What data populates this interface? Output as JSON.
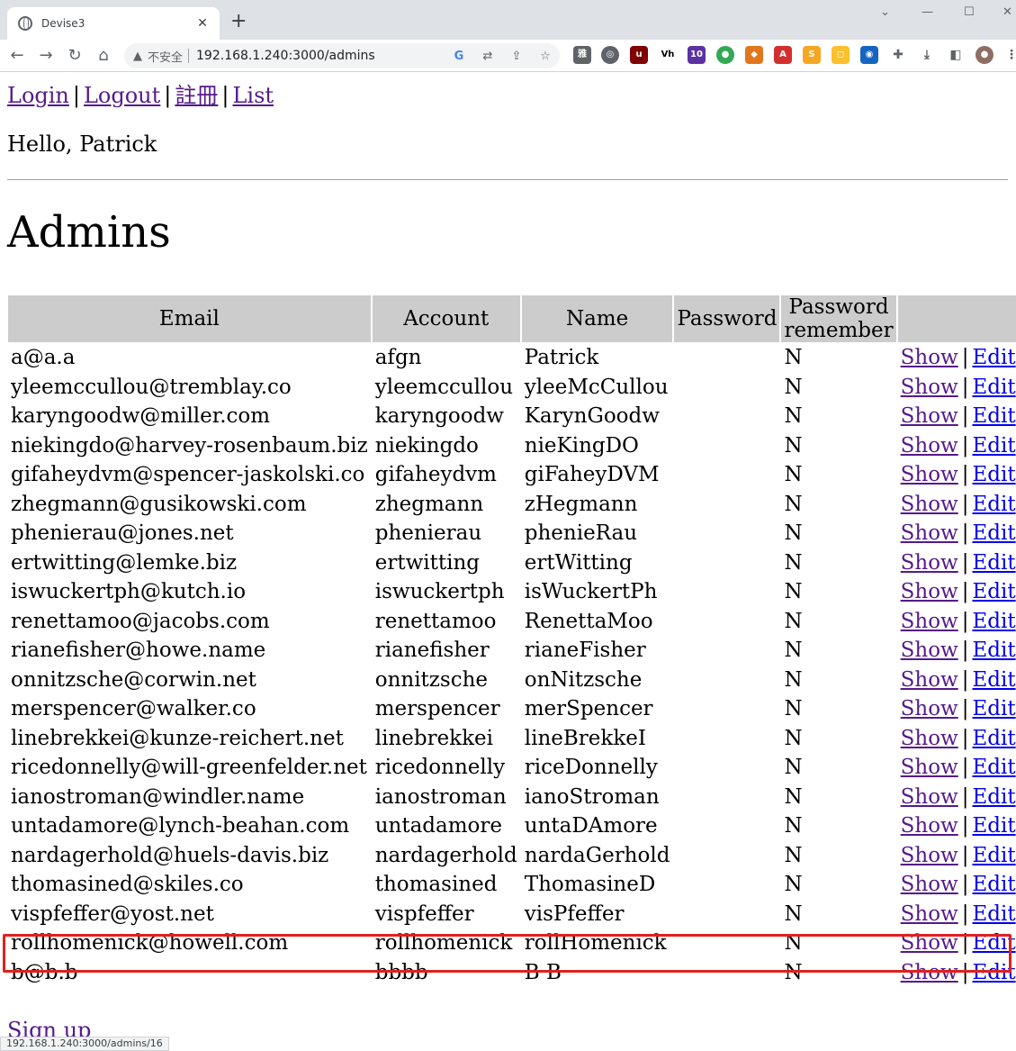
{
  "browser": {
    "tab_title": "Devise3",
    "new_tab": "+",
    "security_label": "不安全",
    "url": "192.168.1.240:3000/admins",
    "status_url": "192.168.1.240:3000/admins/16",
    "extension_badge": "10"
  },
  "nav": {
    "login": "Login",
    "logout": "Logout",
    "register": "註冊",
    "list": "List",
    "separator": "|"
  },
  "greeting": "Hello, Patrick",
  "heading": "Admins",
  "table": {
    "headers": [
      "Email",
      "Account",
      "Name",
      "Password",
      "Password remember",
      ""
    ],
    "show_label": "Show",
    "edit_label": "Edit",
    "rows": [
      {
        "email": "a@a.a",
        "account": "afgn",
        "name": "Patrick",
        "password": "",
        "remember": "N"
      },
      {
        "email": "yleemccullou@tremblay.co",
        "account": "yleemccullou",
        "name": "yleeMcCullou",
        "password": "",
        "remember": "N"
      },
      {
        "email": "karyngoodw@miller.com",
        "account": "karyngoodw",
        "name": "KarynGoodw",
        "password": "",
        "remember": "N"
      },
      {
        "email": "niekingdo@harvey-rosenbaum.biz",
        "account": "niekingdo",
        "name": "nieKingDO",
        "password": "",
        "remember": "N"
      },
      {
        "email": "gifaheydvm@spencer-jaskolski.co",
        "account": "gifaheydvm",
        "name": "giFaheyDVM",
        "password": "",
        "remember": "N"
      },
      {
        "email": "zhegmann@gusikowski.com",
        "account": "zhegmann",
        "name": "zHegmann",
        "password": "",
        "remember": "N"
      },
      {
        "email": "phenierau@jones.net",
        "account": "phenierau",
        "name": "phenieRau",
        "password": "",
        "remember": "N"
      },
      {
        "email": "ertwitting@lemke.biz",
        "account": "ertwitting",
        "name": "ertWitting",
        "password": "",
        "remember": "N"
      },
      {
        "email": "iswuckertph@kutch.io",
        "account": "iswuckertph",
        "name": "isWuckertPh",
        "password": "",
        "remember": "N"
      },
      {
        "email": "renettamoo@jacobs.com",
        "account": "renettamoo",
        "name": "RenettaMoo",
        "password": "",
        "remember": "N"
      },
      {
        "email": "rianefisher@howe.name",
        "account": "rianefisher",
        "name": "rianeFisher",
        "password": "",
        "remember": "N"
      },
      {
        "email": "onnitzsche@corwin.net",
        "account": "onnitzsche",
        "name": "onNitzsche",
        "password": "",
        "remember": "N"
      },
      {
        "email": "merspencer@walker.co",
        "account": "merspencer",
        "name": "merSpencer",
        "password": "",
        "remember": "N"
      },
      {
        "email": "linebrekkei@kunze-reichert.net",
        "account": "linebrekkei",
        "name": "lineBrekkeI",
        "password": "",
        "remember": "N"
      },
      {
        "email": "ricedonnelly@will-greenfelder.net",
        "account": "ricedonnelly",
        "name": "riceDonnelly",
        "password": "",
        "remember": "N"
      },
      {
        "email": "ianostroman@windler.name",
        "account": "ianostroman",
        "name": "ianoStroman",
        "password": "",
        "remember": "N"
      },
      {
        "email": "untadamore@lynch-beahan.com",
        "account": "untadamore",
        "name": "untaDAmore",
        "password": "",
        "remember": "N"
      },
      {
        "email": "nardagerhold@huels-davis.biz",
        "account": "nardagerhold",
        "name": "nardaGerhold",
        "password": "",
        "remember": "N"
      },
      {
        "email": "thomasined@skiles.co",
        "account": "thomasined",
        "name": "ThomasineD",
        "password": "",
        "remember": "N"
      },
      {
        "email": "vispfeffer@yost.net",
        "account": "vispfeffer",
        "name": "visPfeffer",
        "password": "",
        "remember": "N"
      },
      {
        "email": "rollhomenick@howell.com",
        "account": "rollhomenick",
        "name": "rollHomenick",
        "password": "",
        "remember": "N"
      },
      {
        "email": "b@b.b",
        "account": "bbbb",
        "name": "B B",
        "password": "",
        "remember": "N"
      }
    ]
  },
  "signup": "Sign up",
  "colors": {
    "visited_link": "#551a8b",
    "link": "#0000ee",
    "header_bg": "#cccccc",
    "highlight_border": "#e02020"
  }
}
